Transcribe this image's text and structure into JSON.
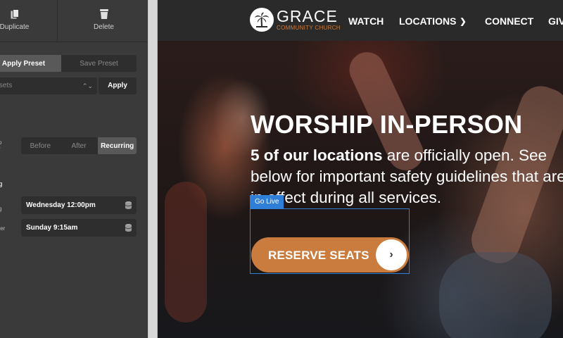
{
  "editor": {
    "toolbar": {
      "duplicate_label": "Duplicate",
      "delete_label": "Delete"
    },
    "preset_tabs": [
      {
        "label": "Apply Preset",
        "active": true
      },
      {
        "label": "Save Preset",
        "active": false
      }
    ],
    "preset_select": {
      "value": "resets"
    },
    "apply_button": "Apply",
    "timing_tabs": [
      {
        "label": "Before",
        "active": false
      },
      {
        "label": "After",
        "active": false
      },
      {
        "label": "Recurring",
        "active": true
      }
    ],
    "side_labels": {
      "timing_a": "o",
      "timing_b": "r",
      "section": "g",
      "field1": "g",
      "field2": "ter"
    },
    "fields": [
      {
        "value": "Wednesday 12:00pm"
      },
      {
        "value": "Sunday 9:15am"
      }
    ]
  },
  "site": {
    "logo": {
      "name": "GRACE",
      "subtitle": "COMMUNITY CHURCH"
    },
    "nav": {
      "watch": "WATCH",
      "locations": "LOCATIONS",
      "connect": "CONNECT",
      "give": "GIV"
    },
    "hero": {
      "title": "WORSHIP IN-PERSON",
      "body_bold": "5 of our locations",
      "body_rest": " are officially open. See below for important safety guidelines that are in effect during all services."
    },
    "selection_tag": "Go Live",
    "cta": {
      "label": "RESERVE SEATS",
      "arrow": "›"
    }
  },
  "colors": {
    "accent_orange": "#c97c3e",
    "selection_blue": "#2f7fd9",
    "panel_bg": "#3a3a3a",
    "navbar_bg": "#2a2a2a"
  },
  "icons": {
    "duplicate": "duplicate-icon",
    "delete": "trash-icon",
    "database": "database-icon",
    "chevron": "chevron-down-icon",
    "updown": "updown-icon"
  }
}
